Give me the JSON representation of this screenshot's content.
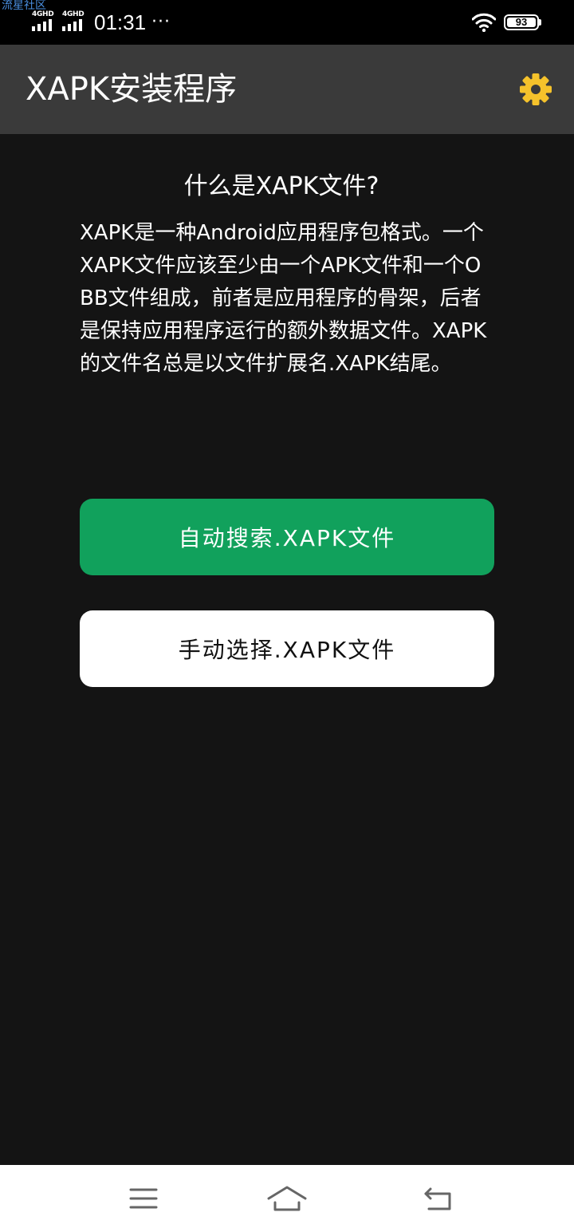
{
  "status_bar": {
    "watermark": "流星社区",
    "network_1": "4GHD",
    "network_2": "4GHD",
    "time": "01:31",
    "more": "···",
    "battery_level": "93",
    "icons": [
      "signal-icon",
      "wifi-icon",
      "battery-icon"
    ]
  },
  "app_bar": {
    "title": "XAPK安装程序",
    "settings_icon": "gear-icon",
    "accent_color": "#f5c22b"
  },
  "main": {
    "heading": "什么是XAPK文件?",
    "description": "XAPK是一种Android应用程序包格式。一个XAPK文件应该至少由一个APK文件和一个OBB文件组成，前者是应用程序的骨架，后者是保持应用程序运行的额外数据文件。XAPK的文件名总是以文件扩展名.XAPK结尾。",
    "auto_search_button": "自动搜索.XAPK文件",
    "manual_select_button": "手动选择.XAPK文件",
    "auto_button_color": "#11a15c"
  },
  "nav_bar": {
    "icons": [
      "menu-icon",
      "home-icon",
      "back-icon"
    ]
  }
}
